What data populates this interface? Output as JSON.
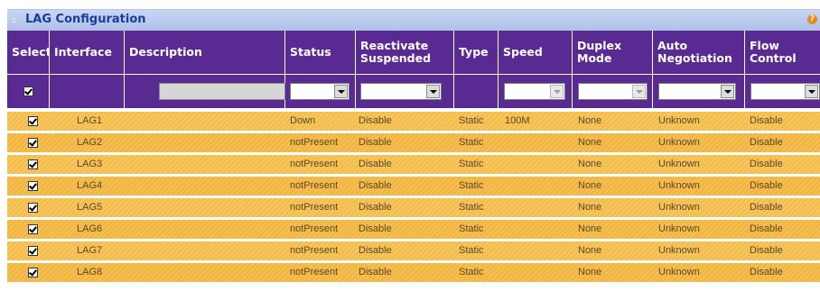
{
  "panel": {
    "title": "LAG Configuration",
    "help_label": "?"
  },
  "columns": {
    "select": "Select",
    "interface": "Interface",
    "description": "Description",
    "status": "Status",
    "reactivate": "Reactivate Suspended",
    "type": "Type",
    "speed": "Speed",
    "duplex": "Duplex Mode",
    "autoneg": "Auto Negotiation",
    "flow": "Flow Control"
  },
  "filter_row": {
    "select_checked": true,
    "description_value": "",
    "status_value": "",
    "reactivate_value": "",
    "speed_value": "",
    "duplex_value": "",
    "autoneg_value": "",
    "flow_value": ""
  },
  "rows": [
    {
      "selected": true,
      "interface": "LAG1",
      "description": "",
      "status": "Down",
      "reactivate": "Disable",
      "type": "Static",
      "speed": "100M",
      "duplex": "None",
      "autoneg": "Unknown",
      "flow": "Disable"
    },
    {
      "selected": true,
      "interface": "LAG2",
      "description": "",
      "status": "notPresent",
      "reactivate": "Disable",
      "type": "Static",
      "speed": "",
      "duplex": "None",
      "autoneg": "Unknown",
      "flow": "Disable"
    },
    {
      "selected": true,
      "interface": "LAG3",
      "description": "",
      "status": "notPresent",
      "reactivate": "Disable",
      "type": "Static",
      "speed": "",
      "duplex": "None",
      "autoneg": "Unknown",
      "flow": "Disable"
    },
    {
      "selected": true,
      "interface": "LAG4",
      "description": "",
      "status": "notPresent",
      "reactivate": "Disable",
      "type": "Static",
      "speed": "",
      "duplex": "None",
      "autoneg": "Unknown",
      "flow": "Disable"
    },
    {
      "selected": true,
      "interface": "LAG5",
      "description": "",
      "status": "notPresent",
      "reactivate": "Disable",
      "type": "Static",
      "speed": "",
      "duplex": "None",
      "autoneg": "Unknown",
      "flow": "Disable"
    },
    {
      "selected": true,
      "interface": "LAG6",
      "description": "",
      "status": "notPresent",
      "reactivate": "Disable",
      "type": "Static",
      "speed": "",
      "duplex": "None",
      "autoneg": "Unknown",
      "flow": "Disable"
    },
    {
      "selected": true,
      "interface": "LAG7",
      "description": "",
      "status": "notPresent",
      "reactivate": "Disable",
      "type": "Static",
      "speed": "",
      "duplex": "None",
      "autoneg": "Unknown",
      "flow": "Disable"
    },
    {
      "selected": true,
      "interface": "LAG8",
      "description": "",
      "status": "notPresent",
      "reactivate": "Disable",
      "type": "Static",
      "speed": "",
      "duplex": "None",
      "autoneg": "Unknown",
      "flow": "Disable"
    }
  ],
  "colors": {
    "header_bg": "#5a2a93",
    "title_text": "#1a3c9a",
    "row_bg": "#f7c04d",
    "help_icon": "#e88a1c"
  }
}
